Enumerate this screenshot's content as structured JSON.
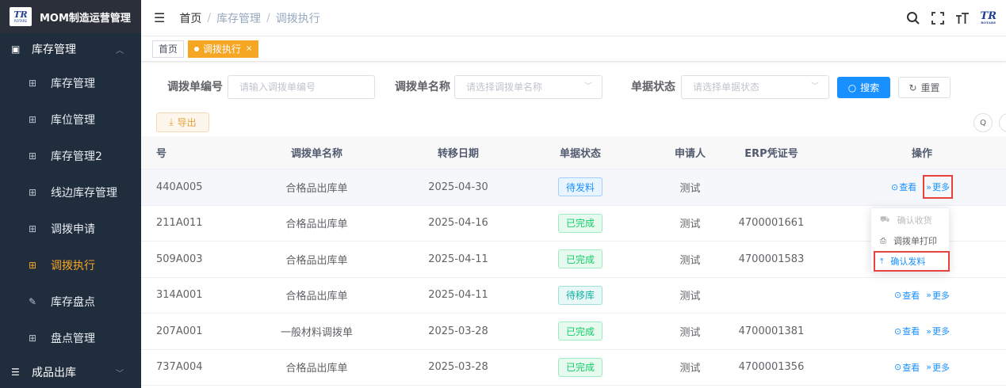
{
  "app": {
    "title": "MOM制造运营管理",
    "logo_text": "TR",
    "logo_sub": "ROTARE"
  },
  "sidebar": {
    "group": {
      "label": "库存管理",
      "icon": "monitor-icon"
    },
    "items": [
      {
        "label": "库存管理",
        "icon": "grid-icon",
        "active": false
      },
      {
        "label": "库位管理",
        "icon": "grid-icon",
        "active": false
      },
      {
        "label": "库存管理2",
        "icon": "grid-icon",
        "active": false
      },
      {
        "label": "线边库存管理",
        "icon": "grid-icon",
        "active": false
      },
      {
        "label": "调拨申请",
        "icon": "grid-icon",
        "active": false
      },
      {
        "label": "调拨执行",
        "icon": "grid-icon",
        "active": true
      },
      {
        "label": "库存盘点",
        "icon": "edit-icon",
        "active": false
      },
      {
        "label": "盘点管理",
        "icon": "grid-icon",
        "active": false
      }
    ],
    "bottom_group": {
      "label": "成品出库",
      "icon": "list-icon"
    }
  },
  "header": {
    "breadcrumb": [
      "首页",
      "库存管理",
      "调拨执行"
    ]
  },
  "tags": [
    {
      "label": "首页",
      "active": false
    },
    {
      "label": "调拨执行",
      "active": true
    }
  ],
  "search": {
    "code_label": "调拨单编号",
    "code_placeholder": "请输入调拨单编号",
    "name_label": "调拨单名称",
    "name_placeholder": "请选择调拨单名称",
    "status_label": "单据状态",
    "status_placeholder": "请选择单据状态",
    "search_button": "搜索",
    "reset_button": "重置"
  },
  "toolbar": {
    "export_label": "导出"
  },
  "table": {
    "columns": [
      "号",
      "调拨单名称",
      "转移日期",
      "单据状态",
      "申请人",
      "ERP凭证号",
      "操作"
    ],
    "rows": [
      {
        "code": "440A005",
        "name": "合格品出库单",
        "date": "2025-04-30",
        "status": "待发料",
        "status_type": "wait",
        "person": "测试",
        "erp": ""
      },
      {
        "code": "211A011",
        "name": "合格品出库单",
        "date": "2025-04-16",
        "status": "已完成",
        "status_type": "done",
        "person": "测试",
        "erp": "4700001661"
      },
      {
        "code": "509A003",
        "name": "合格品出库单",
        "date": "2025-04-11",
        "status": "已完成",
        "status_type": "done",
        "person": "测试",
        "erp": "4700001583"
      },
      {
        "code": "314A001",
        "name": "合格品出库单",
        "date": "2025-04-11",
        "status": "待移库",
        "status_type": "move",
        "person": "测试",
        "erp": ""
      },
      {
        "code": "207A001",
        "name": "一般材料调拨单",
        "date": "2025-03-28",
        "status": "已完成",
        "status_type": "done",
        "person": "测试",
        "erp": "4700001381"
      },
      {
        "code": "737A004",
        "name": "合格品出库单",
        "date": "2025-03-28",
        "status": "已完成",
        "status_type": "done",
        "person": "测试",
        "erp": "4700001356"
      }
    ],
    "view_label": "查看",
    "more_label": "更多"
  },
  "dropdown": {
    "items": [
      {
        "label": "确认收货",
        "icon": "truck-icon",
        "disabled": true
      },
      {
        "label": "调拨单打印",
        "icon": "printer-icon",
        "disabled": false
      },
      {
        "label": "确认发料",
        "icon": "upload-icon",
        "disabled": false
      }
    ]
  },
  "colors": {
    "accent": "#f5a623",
    "primary": "#1890ff",
    "sidebar_bg": "#1f2d3d",
    "highlight_box": "#e8423f"
  }
}
